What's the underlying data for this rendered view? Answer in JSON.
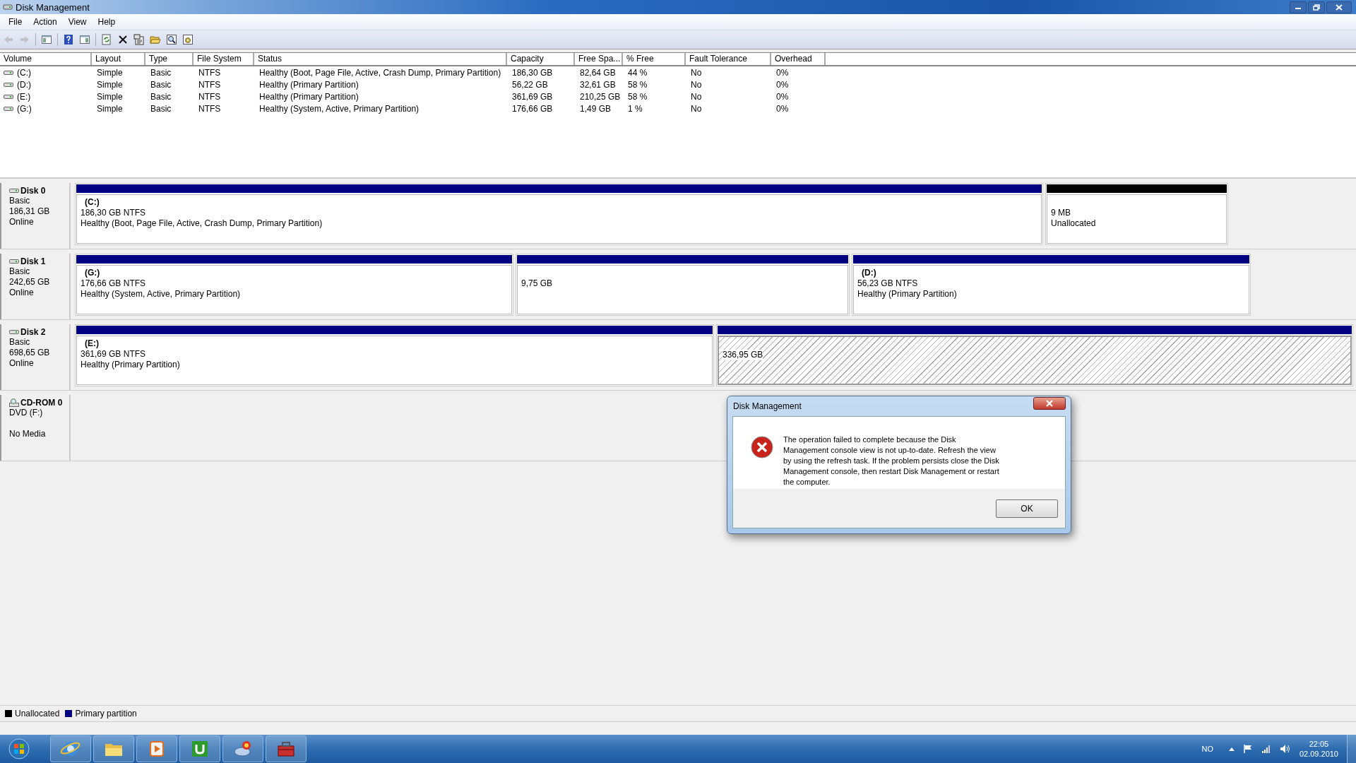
{
  "window": {
    "title": "Disk Management"
  },
  "menu": [
    "File",
    "Action",
    "View",
    "Help"
  ],
  "toolbar": [
    {
      "kind": "back",
      "disabled": true
    },
    {
      "kind": "forward",
      "disabled": true
    },
    {
      "kind": "tree",
      "disabled": false
    },
    {
      "kind": "help",
      "disabled": false
    },
    {
      "kind": "pane",
      "disabled": false
    },
    {
      "kind": "refresh",
      "disabled": false
    },
    {
      "kind": "delete",
      "disabled": false
    },
    {
      "kind": "properties",
      "disabled": false
    },
    {
      "kind": "open",
      "disabled": false
    },
    {
      "kind": "search",
      "disabled": false
    },
    {
      "kind": "settings",
      "disabled": false
    }
  ],
  "table": {
    "columns": [
      "Volume",
      "Layout",
      "Type",
      "File System",
      "Status",
      "Capacity",
      "Free Spa...",
      "% Free",
      "Fault Tolerance",
      "Overhead"
    ],
    "rows": [
      [
        "(C:)",
        "Simple",
        "Basic",
        "NTFS",
        "Healthy (Boot, Page File, Active, Crash Dump, Primary Partition)",
        "186,30 GB",
        "82,64 GB",
        "44 %",
        "No",
        "0%"
      ],
      [
        "(D:)",
        "Simple",
        "Basic",
        "NTFS",
        "Healthy (Primary Partition)",
        "56,22 GB",
        "32,61 GB",
        "58 %",
        "No",
        "0%"
      ],
      [
        "(E:)",
        "Simple",
        "Basic",
        "NTFS",
        "Healthy (Primary Partition)",
        "361,69 GB",
        "210,25 GB",
        "58 %",
        "No",
        "0%"
      ],
      [
        "(G:)",
        "Simple",
        "Basic",
        "NTFS",
        "Healthy (System, Active, Primary Partition)",
        "176,66 GB",
        "1,49 GB",
        "1 %",
        "No",
        "0%"
      ]
    ]
  },
  "disks": [
    {
      "kind": "disk",
      "name": "Disk 0",
      "type": "Basic",
      "size": "186,31 GB",
      "status": "Online",
      "partitions": [
        {
          "kind": "partition",
          "label": "(C:)",
          "size": "186,30 GB NTFS",
          "status": "Healthy (Boot, Page File, Active, Crash Dump, Primary Partition)"
        },
        {
          "kind": "unallocated",
          "size": "9 MB",
          "status": "Unallocated"
        }
      ]
    },
    {
      "kind": "disk",
      "name": "Disk 1",
      "type": "Basic",
      "size": "242,65 GB",
      "status": "Online",
      "partitions": [
        {
          "kind": "partition",
          "label": "(G:)",
          "size": "176,66 GB NTFS",
          "status": "Healthy (System, Active, Primary Partition)"
        },
        {
          "kind": "partition",
          "size": "9,75 GB"
        },
        {
          "kind": "partition",
          "label": "(D:)",
          "size": "56,23 GB NTFS",
          "status": "Healthy (Primary Partition)"
        }
      ]
    },
    {
      "kind": "disk",
      "name": "Disk 2",
      "type": "Basic",
      "size": "698,65 GB",
      "status": "Online",
      "partitions": [
        {
          "kind": "partition",
          "label": "(E:)",
          "size": "361,69 GB NTFS",
          "status": "Healthy (Primary Partition)"
        },
        {
          "kind": "free",
          "size": "336,95 GB"
        }
      ]
    },
    {
      "kind": "cdrom",
      "name": "CD-ROM 0",
      "type": "DVD (F:)",
      "status": "No Media"
    }
  ],
  "legend": [
    {
      "label": "Unallocated",
      "color": "#000000"
    },
    {
      "label": "Primary partition",
      "color": "#000080"
    }
  ],
  "dialog": {
    "title": "Disk Management",
    "message": "The operation failed to complete because the Disk Management console view is not up-to-date.  Refresh the view by using the refresh task. If the problem persists close the Disk Management console, then restart Disk Management or restart the computer.",
    "button": "OK"
  },
  "taskbar": {
    "language": "NO",
    "time": "22:05",
    "date": "02.09.2010"
  }
}
